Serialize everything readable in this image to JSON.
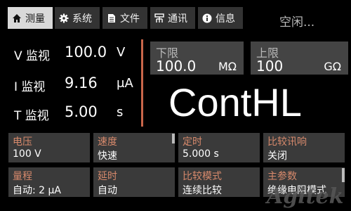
{
  "tabs": [
    {
      "label": "测量",
      "icon": "home-icon"
    },
    {
      "label": "系统",
      "icon": "gear-icon"
    },
    {
      "label": "文件",
      "icon": "document-icon"
    },
    {
      "label": "通讯",
      "icon": "network-icon"
    },
    {
      "label": "信息",
      "icon": "info-icon"
    }
  ],
  "status": "空闲...",
  "measurements": [
    {
      "label": "V 监视",
      "value": "100.0",
      "unit": "V"
    },
    {
      "label": "I 监视",
      "value": "9.16",
      "unit": "μA"
    },
    {
      "label": "T 监视",
      "value": "5.00",
      "unit": "s"
    }
  ],
  "lower_limit": {
    "title": "下限",
    "value": "100.0",
    "unit": "MΩ"
  },
  "upper_limit": {
    "title": "上限",
    "value": "100",
    "unit": "GΩ"
  },
  "result": "ContHL",
  "params": [
    {
      "label": "电压",
      "value": "100 V"
    },
    {
      "label": "速度",
      "value": "快速"
    },
    {
      "label": "定时",
      "value": "5.000 s"
    },
    {
      "label": "比较讯响",
      "value": "关闭"
    },
    {
      "label": "量程",
      "value": "自动: 2 μA"
    },
    {
      "label": "延时",
      "value": "自动"
    },
    {
      "label": "比较模式",
      "value": "连续比较"
    },
    {
      "label": "主参数",
      "value": "绝缘电阻模式"
    }
  ],
  "watermark": "Agitek",
  "colors": {
    "accent": "#c9664a",
    "param_label": "#d88a6c",
    "active_tab": "#d9d9d9",
    "panel": "#3a3a3a"
  }
}
